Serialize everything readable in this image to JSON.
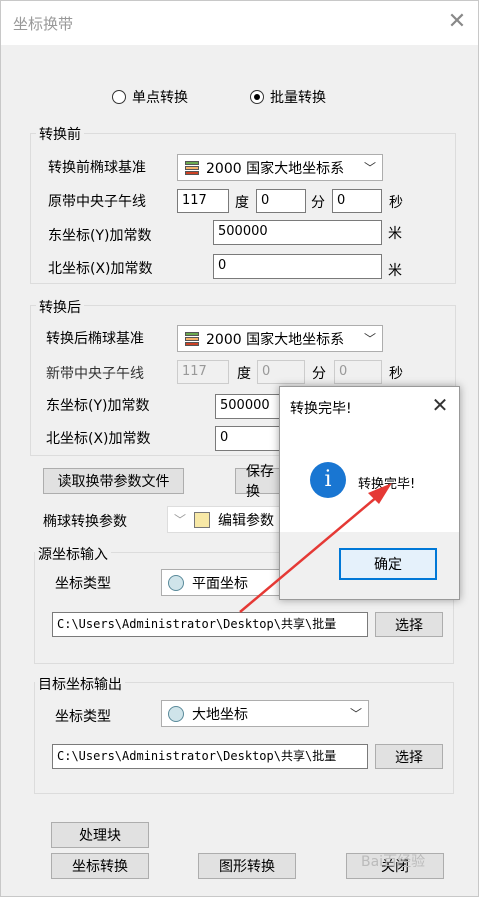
{
  "window": {
    "title": "坐标换带",
    "close": "✕"
  },
  "mode": {
    "single": "单点转换",
    "batch": "批量转换",
    "selected": "批量转换"
  },
  "before": {
    "legend": "转换前",
    "ellipsoid_label": "转换前椭球基准",
    "ellipsoid_value": "2000 国家大地坐标系",
    "meridian_label": "原带中央子午线",
    "deg": "117",
    "deg_unit": "度",
    "min": "0",
    "min_unit": "分",
    "sec": "0",
    "sec_unit": "秒",
    "east_label": "东坐标(Y)加常数",
    "east_value": "500000",
    "east_unit": "米",
    "north_label": "北坐标(X)加常数",
    "north_value": "0",
    "north_unit": "米"
  },
  "after": {
    "legend": "转换后",
    "ellipsoid_label": "转换后椭球基准",
    "ellipsoid_value": "2000 国家大地坐标系",
    "meridian_label": "新带中央子午线",
    "deg": "117",
    "deg_unit": "度",
    "min": "0",
    "min_unit": "分",
    "sec": "0",
    "sec_unit": "秒",
    "east_label": "东坐标(Y)加常数",
    "east_value": "500000",
    "north_label": "北坐标(X)加常数",
    "north_value": "0"
  },
  "params": {
    "read_btn": "读取换带参数文件",
    "save_btn": "保存换",
    "ellipsoid_params_label": "椭球转换参数",
    "edit_params": "编辑参数"
  },
  "source": {
    "legend": "源坐标输入",
    "type_label": "坐标类型",
    "type_value": "平面坐标",
    "path": "C:\\Users\\Administrator\\Desktop\\共享\\批量",
    "choose": "选择"
  },
  "target": {
    "legend": "目标坐标输出",
    "type_label": "坐标类型",
    "type_value": "大地坐标",
    "path": "C:\\Users\\Administrator\\Desktop\\共享\\批量",
    "choose": "选择"
  },
  "footer": {
    "process_block": "处理块",
    "coord_convert": "坐标转换",
    "graphic_convert": "图形转换",
    "close": "关闭"
  },
  "dialog": {
    "title": "转换完毕!",
    "close": "✕",
    "message": "转换完毕!",
    "ok": "确定",
    "icon_glyph": "i"
  },
  "watermark": "Bai百经验",
  "colors": {
    "accent": "#0078d7",
    "info": "#1976d2",
    "arrow": "#e53935"
  }
}
